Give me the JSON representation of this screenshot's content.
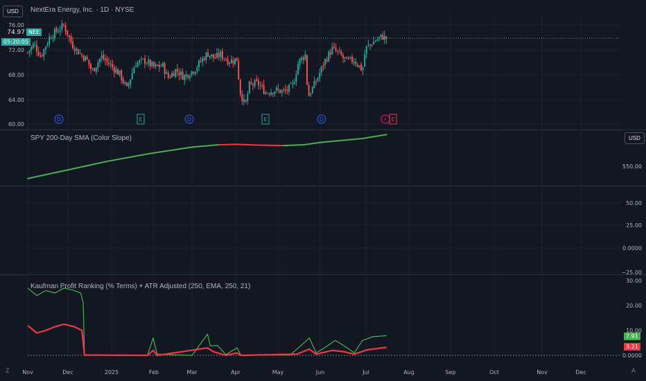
{
  "colors": {
    "background": "#131722",
    "up": "#26a69a",
    "down": "#ef5350",
    "green_line": "#4caf50",
    "red_line": "#f23645",
    "grid": "#1e222d"
  },
  "currency_badge_top": "USD",
  "currency_badge_sma": "USD",
  "symbol_title": "NextEra Energy, Inc. · 1D · NYSE",
  "price_tag": {
    "ticker": "NEE",
    "value": "74.97",
    "countdown": "05:20:05"
  },
  "sma_title": "SPY 200-Day SMA (Color Slope)",
  "kaufman_title": "Kaufman Profit Ranking (% Terms) + ATR Adjusted (250, EMA, 250, 21)",
  "kaufman_tags": {
    "green": "7.91",
    "red": "3.21"
  },
  "bottom_icons": {
    "left": "Z",
    "right": "A"
  },
  "event_markers": [
    {
      "label": "D",
      "type": "dividend"
    },
    {
      "label": "E",
      "type": "earnings"
    },
    {
      "label": "D",
      "type": "dividend"
    },
    {
      "label": "E",
      "type": "earnings"
    },
    {
      "label": "D",
      "type": "dividend"
    },
    {
      "label": "⚡",
      "type": "flash"
    },
    {
      "label": "E",
      "type": "earnings"
    }
  ],
  "chart_data": [
    {
      "type": "candlestick",
      "title": "NextEra Energy, Inc. · 1D · NYSE",
      "y_ticks": [
        "76.00",
        "72.00",
        "68.00",
        "64.00",
        "60.00"
      ],
      "ylim": [
        60,
        78
      ],
      "last_price": 74.97,
      "close_path": [
        {
          "x": "Nov 01",
          "y": 72.5
        },
        {
          "x": "Nov 06",
          "y": 74.0
        },
        {
          "x": "Nov 11",
          "y": 71.8
        },
        {
          "x": "Nov 18",
          "y": 75.2
        },
        {
          "x": "Nov 25",
          "y": 76.5
        },
        {
          "x": "Nov 29",
          "y": 77.2
        },
        {
          "x": "Dec 04",
          "y": 74.0
        },
        {
          "x": "Dec 10",
          "y": 72.4
        },
        {
          "x": "Dec 16",
          "y": 71.2
        },
        {
          "x": "Dec 20",
          "y": 69.2
        },
        {
          "x": "Dec 27",
          "y": 71.8
        },
        {
          "x": "Jan 03",
          "y": 70.4
        },
        {
          "x": "Jan 10",
          "y": 68.7
        },
        {
          "x": "Jan 15",
          "y": 66.2
        },
        {
          "x": "Jan 21",
          "y": 70.6
        },
        {
          "x": "Jan 28",
          "y": 71.1
        },
        {
          "x": "Feb 04",
          "y": 69.9
        },
        {
          "x": "Feb 10",
          "y": 70.3
        },
        {
          "x": "Feb 14",
          "y": 68.1
        },
        {
          "x": "Feb 20",
          "y": 69.5
        },
        {
          "x": "Feb 26",
          "y": 68.3
        },
        {
          "x": "Mar 03",
          "y": 69.6
        },
        {
          "x": "Mar 07",
          "y": 70.9
        },
        {
          "x": "Mar 12",
          "y": 72.4
        },
        {
          "x": "Mar 17",
          "y": 71.5
        },
        {
          "x": "Mar 21",
          "y": 72.2
        },
        {
          "x": "Mar 27",
          "y": 71.0
        },
        {
          "x": "Apr 02",
          "y": 71.3
        },
        {
          "x": "Apr 04",
          "y": 65.9
        },
        {
          "x": "Apr 08",
          "y": 63.2
        },
        {
          "x": "Apr 11",
          "y": 66.8
        },
        {
          "x": "Apr 17",
          "y": 67.2
        },
        {
          "x": "Apr 23",
          "y": 65.6
        },
        {
          "x": "Apr 29",
          "y": 66.0
        },
        {
          "x": "May 06",
          "y": 65.7
        },
        {
          "x": "May 12",
          "y": 66.8
        },
        {
          "x": "May 16",
          "y": 70.8
        },
        {
          "x": "May 21",
          "y": 72.2
        },
        {
          "x": "May 23",
          "y": 64.8
        },
        {
          "x": "May 29",
          "y": 67.5
        },
        {
          "x": "Jun 04",
          "y": 70.9
        },
        {
          "x": "Jun 10",
          "y": 73.2
        },
        {
          "x": "Jun 16",
          "y": 72.0
        },
        {
          "x": "Jun 20",
          "y": 71.0
        },
        {
          "x": "Jun 26",
          "y": 71.2
        },
        {
          "x": "Jul 01",
          "y": 69.4
        },
        {
          "x": "Jul 03",
          "y": 73.2
        },
        {
          "x": "Jul 09",
          "y": 74.5
        },
        {
          "x": "Jul 14",
          "y": 75.3
        },
        {
          "x": "Jul 17",
          "y": 74.97
        }
      ]
    },
    {
      "type": "line",
      "title": "SPY 200-Day SMA (Color Slope)",
      "y_ticks": [
        "550.00"
      ],
      "series": [
        {
          "values": [
            {
              "x": "Nov 01",
              "y": 520,
              "slope": "up"
            },
            {
              "x": "Dec 01",
              "y": 531,
              "slope": "up"
            },
            {
              "x": "Jan 01",
              "y": 542,
              "slope": "up"
            },
            {
              "x": "Feb 01",
              "y": 552,
              "slope": "up"
            },
            {
              "x": "Mar 01",
              "y": 560,
              "slope": "up"
            },
            {
              "x": "Mar 20",
              "y": 563,
              "slope": "up"
            },
            {
              "x": "Apr 01",
              "y": 563.5,
              "slope": "down"
            },
            {
              "x": "Apr 20",
              "y": 562.5,
              "slope": "down"
            },
            {
              "x": "May 05",
              "y": 562,
              "slope": "down"
            },
            {
              "x": "May 20",
              "y": 563,
              "slope": "up"
            },
            {
              "x": "Jun 01",
              "y": 566,
              "slope": "up"
            },
            {
              "x": "Jul 01",
              "y": 571,
              "slope": "up"
            },
            {
              "x": "Jul 17",
              "y": 576,
              "slope": "up"
            }
          ]
        }
      ]
    },
    {
      "type": "line",
      "title": "",
      "y_ticks": [
        "50.00",
        "25.00",
        "0.0000",
        "−25.00"
      ],
      "series": []
    },
    {
      "type": "line",
      "title": "Kaufman Profit Ranking (% Terms) + ATR Adjusted (250, EMA, 250, 21)",
      "y_ticks": [
        "30.00",
        "20.00",
        "10.00",
        "0.0000"
      ],
      "ylim": [
        0,
        30
      ],
      "series": [
        {
          "color": "green",
          "last": 7.91,
          "values": [
            {
              "x": "Nov 01",
              "y": 27
            },
            {
              "x": "Nov 08",
              "y": 24
            },
            {
              "x": "Nov 15",
              "y": 26
            },
            {
              "x": "Nov 22",
              "y": 25
            },
            {
              "x": "Nov 29",
              "y": 27
            },
            {
              "x": "Dec 06",
              "y": 26
            },
            {
              "x": "Dec 11",
              "y": 25
            },
            {
              "x": "Dec 13",
              "y": 21
            },
            {
              "x": "Dec 14",
              "y": 0.2
            },
            {
              "x": "Jan 10",
              "y": 0
            },
            {
              "x": "Jan 30",
              "y": 0.1
            },
            {
              "x": "Feb 03",
              "y": 7
            },
            {
              "x": "Feb 06",
              "y": 0.5
            },
            {
              "x": "Mar 01",
              "y": 0
            },
            {
              "x": "Mar 12",
              "y": 8.5
            },
            {
              "x": "Mar 14",
              "y": 3.8
            },
            {
              "x": "Mar 19",
              "y": 4
            },
            {
              "x": "Mar 25",
              "y": 0.3
            },
            {
              "x": "Apr 02",
              "y": 3
            },
            {
              "x": "Apr 05",
              "y": 0
            },
            {
              "x": "May 10",
              "y": 0.2
            },
            {
              "x": "May 18",
              "y": 4
            },
            {
              "x": "May 24",
              "y": 7
            },
            {
              "x": "May 29",
              "y": 1
            },
            {
              "x": "Jun 04",
              "y": 3
            },
            {
              "x": "Jun 12",
              "y": 6
            },
            {
              "x": "Jun 18",
              "y": 4
            },
            {
              "x": "Jun 26",
              "y": 1
            },
            {
              "x": "Jul 01",
              "y": 6
            },
            {
              "x": "Jul 08",
              "y": 7.5
            },
            {
              "x": "Jul 17",
              "y": 7.91
            }
          ]
        },
        {
          "color": "red",
          "last": 3.21,
          "values": [
            {
              "x": "Nov 01",
              "y": 12
            },
            {
              "x": "Nov 08",
              "y": 9
            },
            {
              "x": "Nov 15",
              "y": 10
            },
            {
              "x": "Nov 22",
              "y": 11.5
            },
            {
              "x": "Nov 29",
              "y": 12.5
            },
            {
              "x": "Dec 06",
              "y": 11.5
            },
            {
              "x": "Dec 12",
              "y": 10
            },
            {
              "x": "Dec 14",
              "y": 0.1
            },
            {
              "x": "Jan 30",
              "y": 0
            },
            {
              "x": "Feb 03",
              "y": 2
            },
            {
              "x": "Feb 06",
              "y": 0
            },
            {
              "x": "Mar 12",
              "y": 3
            },
            {
              "x": "Mar 16",
              "y": 1.5
            },
            {
              "x": "Mar 25",
              "y": 0
            },
            {
              "x": "Apr 02",
              "y": 1
            },
            {
              "x": "Apr 05",
              "y": 0
            },
            {
              "x": "May 15",
              "y": 0.5
            },
            {
              "x": "May 24",
              "y": 2.5
            },
            {
              "x": "May 29",
              "y": 0.5
            },
            {
              "x": "Jun 10",
              "y": 2
            },
            {
              "x": "Jun 18",
              "y": 1.5
            },
            {
              "x": "Jun 26",
              "y": 0.5
            },
            {
              "x": "Jul 04",
              "y": 2.2
            },
            {
              "x": "Jul 17",
              "y": 3.21
            }
          ]
        }
      ]
    }
  ],
  "x_axis_labels": [
    "Nov",
    "Dec",
    "2025",
    "Feb",
    "Mar",
    "Apr",
    "May",
    "Jun",
    "Jul",
    "Aug",
    "Sep",
    "Oct",
    "Nov",
    "Dec"
  ]
}
